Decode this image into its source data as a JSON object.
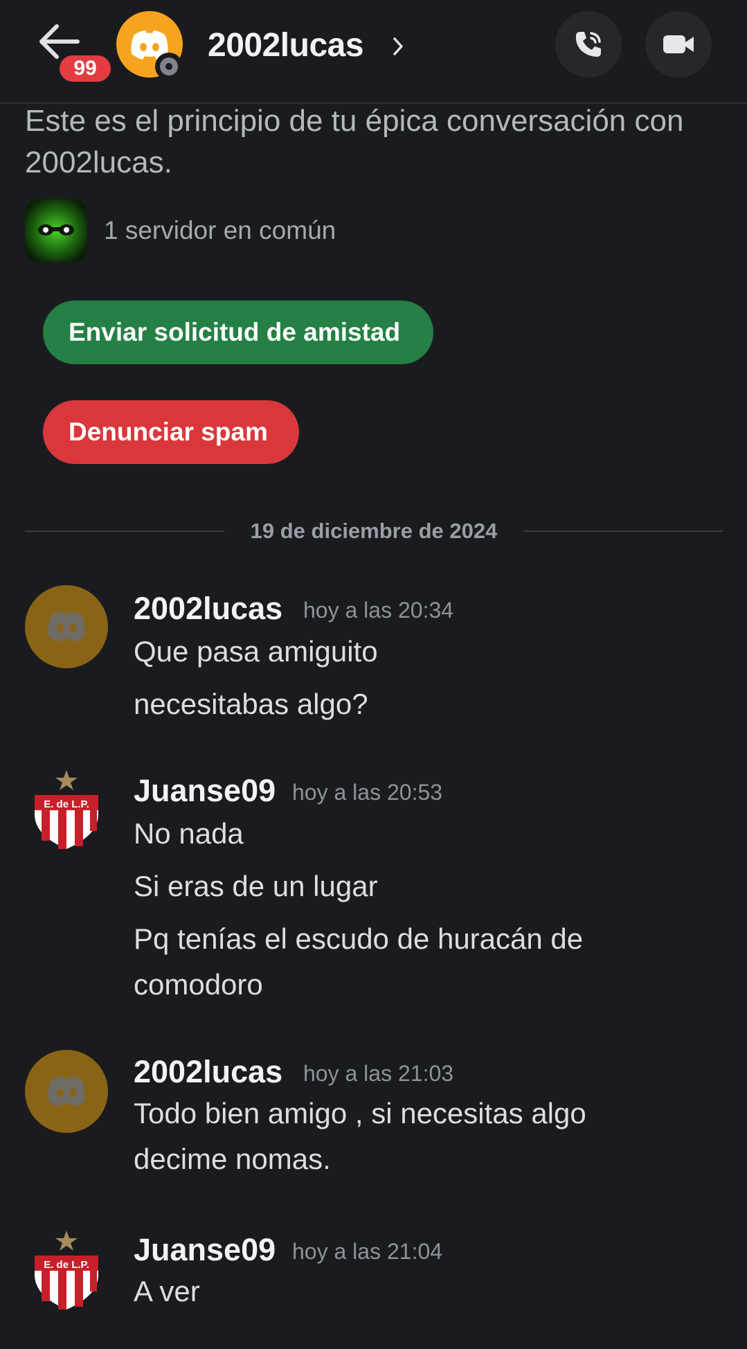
{
  "header": {
    "unread_badge": "99",
    "username": "2002lucas"
  },
  "intro": {
    "text": "Este es el principio de tu épica conversación con 2002lucas.",
    "mutual_servers": "1 servidor en común"
  },
  "actions": {
    "friend_request": "Enviar solicitud de amistad",
    "report_spam": "Denunciar spam"
  },
  "date_divider": "19 de diciembre de 2024",
  "messages": [
    {
      "author": "2002lucas",
      "time": "hoy a las 20:34",
      "lines": [
        "Que pasa amiguito",
        "necesitabas algo?"
      ]
    },
    {
      "author": "Juanse09",
      "time": "hoy a las 20:53",
      "lines": [
        "No nada",
        "Si eras de un lugar",
        "Pq tenías el escudo de huracán de",
        "comodoro"
      ]
    },
    {
      "author": "2002lucas",
      "time": "hoy a las 21:03",
      "lines": [
        "Todo bien amigo , si necesitas algo",
        "decime nomas."
      ]
    },
    {
      "author": "Juanse09",
      "time": "hoy a las 21:04",
      "lines": [
        "A ver"
      ]
    }
  ],
  "crest_text": "E. de L.P.",
  "colors": {
    "background": "#1a1b1f",
    "friend_button": "#248045",
    "spam_button": "#da373c",
    "badge": "#e33d42",
    "header_avatar": "#f6a41f"
  },
  "icons": [
    "back-arrow-icon",
    "discord-logo-icon",
    "chevron-right-icon",
    "phone-icon",
    "video-camera-icon",
    "star-icon"
  ]
}
